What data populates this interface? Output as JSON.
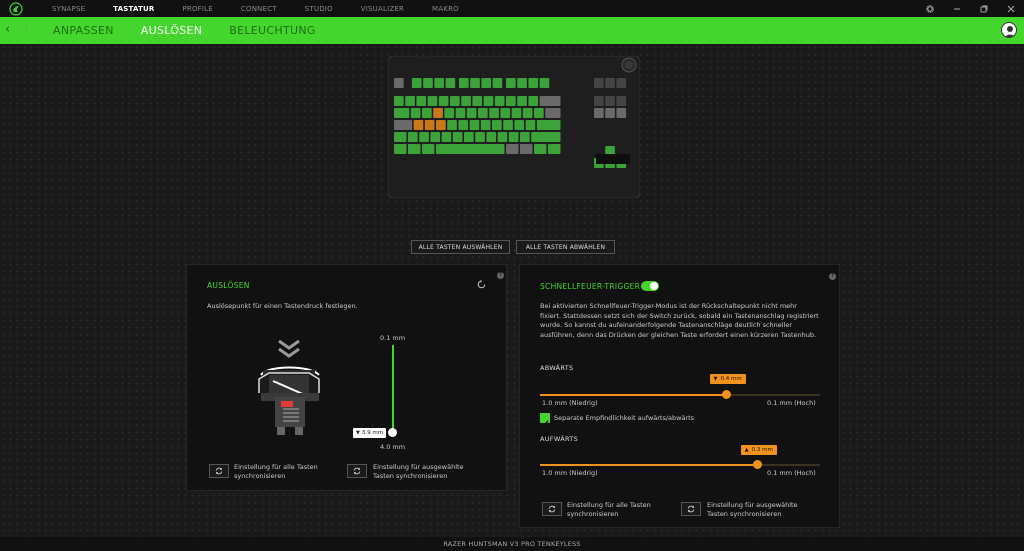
{
  "nav": {
    "items": [
      "SYNAPSE",
      "TASTATUR",
      "PROFILE",
      "CONNECT",
      "STUDIO",
      "VISUALIZER",
      "MAKRO"
    ],
    "active": "TASTATUR"
  },
  "window_controls": [
    "settings-icon",
    "minimize-icon",
    "maximize-icon",
    "close-icon"
  ],
  "subnav": {
    "items": [
      "ANPASSEN",
      "AUSLÖSEN",
      "BELEUCHTUNG"
    ],
    "active": "AUSLÖSEN"
  },
  "buttons": {
    "select_all": "ALLE TASTEN AUSWÄHLEN",
    "deselect_all": "ALLE TASTEN ABWÄHLEN"
  },
  "actuation": {
    "title": "AUSLÖSEN",
    "description": "Auslösepunkt für einen Tastendruck festlegen.",
    "slider_min": "0.1 mm",
    "slider_max": "4.0 mm",
    "value_label": "3.9 mm",
    "value": 3.9,
    "range": [
      0.1,
      4.0
    ],
    "sync_all": "Einstellung für alle Tasten synchronisieren",
    "sync_selected": "Einstellung für ausgewählte Tasten synchronisieren"
  },
  "rapid": {
    "title": "SCHNELLFEUER-TRIGGER",
    "enabled": true,
    "description": "Bei aktivierten Schnellfeuer-Trigger-Modus ist der Rückschaltepunkt nicht mehr fixiert. Stattdessen setzt sich der Switch zurück, sobald ein Tastenanschlag registriert wurde. So kannst du aufeinanderfolgende Tastenanschläge deutlich schneller ausführen, denn das Drücken der gleichen Taste erfordert einen kürzeren Tastenhub.",
    "down": {
      "label": "ABWÄRTS",
      "value_label": "0.4 mm",
      "value": 0.4,
      "range": [
        1.0,
        0.1
      ],
      "min_label": "1.0 mm (Niedrig)",
      "max_label": "0.1 mm (Hoch)"
    },
    "separate_label": "Separate Empfindlichkeit aufwärts/abwärts",
    "separate_checked": true,
    "up": {
      "label": "AUFWÄRTS",
      "value_label": "0.3 mm",
      "value": 0.3,
      "range": [
        1.0,
        0.1
      ],
      "min_label": "1.0 mm (Niedrig)",
      "max_label": "0.1 mm (Hoch)"
    },
    "sync_all": "Einstellung für alle Tasten synchronisieren",
    "sync_selected": "Einstellung für ausgewählte Tasten synchronisieren"
  },
  "device_name": "RAZER HUNTSMAN V3 PRO TENKEYLESS",
  "colors": {
    "accent": "#44d62c",
    "slider": "#f0921e",
    "panel": "#111111"
  }
}
